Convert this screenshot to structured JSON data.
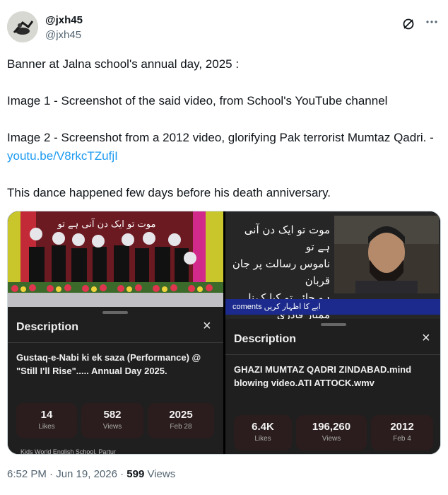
{
  "tweet": {
    "display_name": "@jxh45",
    "handle": "@jxh45",
    "text_line1": "Banner at Jalna school's annual day, 2025 :",
    "text_line2": "Image 1 - Screenshot of the said video, from School's YouTube channel",
    "text_line3_a": "Image 2 - Screenshot from a 2012 video, glorifying Pak terrorist Mumtaz Qadri. - ",
    "text_line3_link": "youtu.be/V8rkcTZufjI",
    "text_line4": "This dance happened few days before his death anniversary.",
    "timestamp": "6:52 PM · Jun 19, 2026 · ",
    "views_count": "599",
    "views_label": " Views"
  },
  "icons": {
    "grok": "slash-circle-icon",
    "more": "more-horizontal-icon",
    "close": "close-icon"
  },
  "media": {
    "image1": {
      "banner_text": "موت تو ایک دن آنی ہے تو",
      "desc_heading": "Description",
      "close_glyph": "×",
      "video_title": "Gustaq-e-Nabi ki ek saza (Performance) @ \"Still I'll Rise\"..... Annual Day 2025.",
      "stats": [
        {
          "value": "14",
          "label": "Likes"
        },
        {
          "value": "582",
          "label": "Views"
        },
        {
          "value": "2025",
          "label": "Feb 28"
        }
      ],
      "channel": "Kids World English School, Partur"
    },
    "image2": {
      "urdu_line1": "موت تو ایک دن آنی ہے تو",
      "urdu_line2": "ناموس رسالت پر جان قربان",
      "urdu_line3": "ہو جائے تو کیا کہنا ممتاز قادری",
      "ticker": "coments ایے کا اظہار کریں",
      "desc_heading": "Description",
      "close_glyph": "×",
      "video_title": "GHAZI MUMTAZ QADRI ZINDABAD.mind blowing video.ATI ATTOCK.wmv",
      "stats": [
        {
          "value": "6.4K",
          "label": "Likes"
        },
        {
          "value": "196,260",
          "label": "Views"
        },
        {
          "value": "2012",
          "label": "Feb 4"
        }
      ]
    }
  },
  "colors": {
    "link": "#1d9bf0",
    "muted": "#536471",
    "dark_panel": "#1f1f1f",
    "stat_bg": "#2b1d1d",
    "ticker_bg": "#1b2a8c"
  }
}
